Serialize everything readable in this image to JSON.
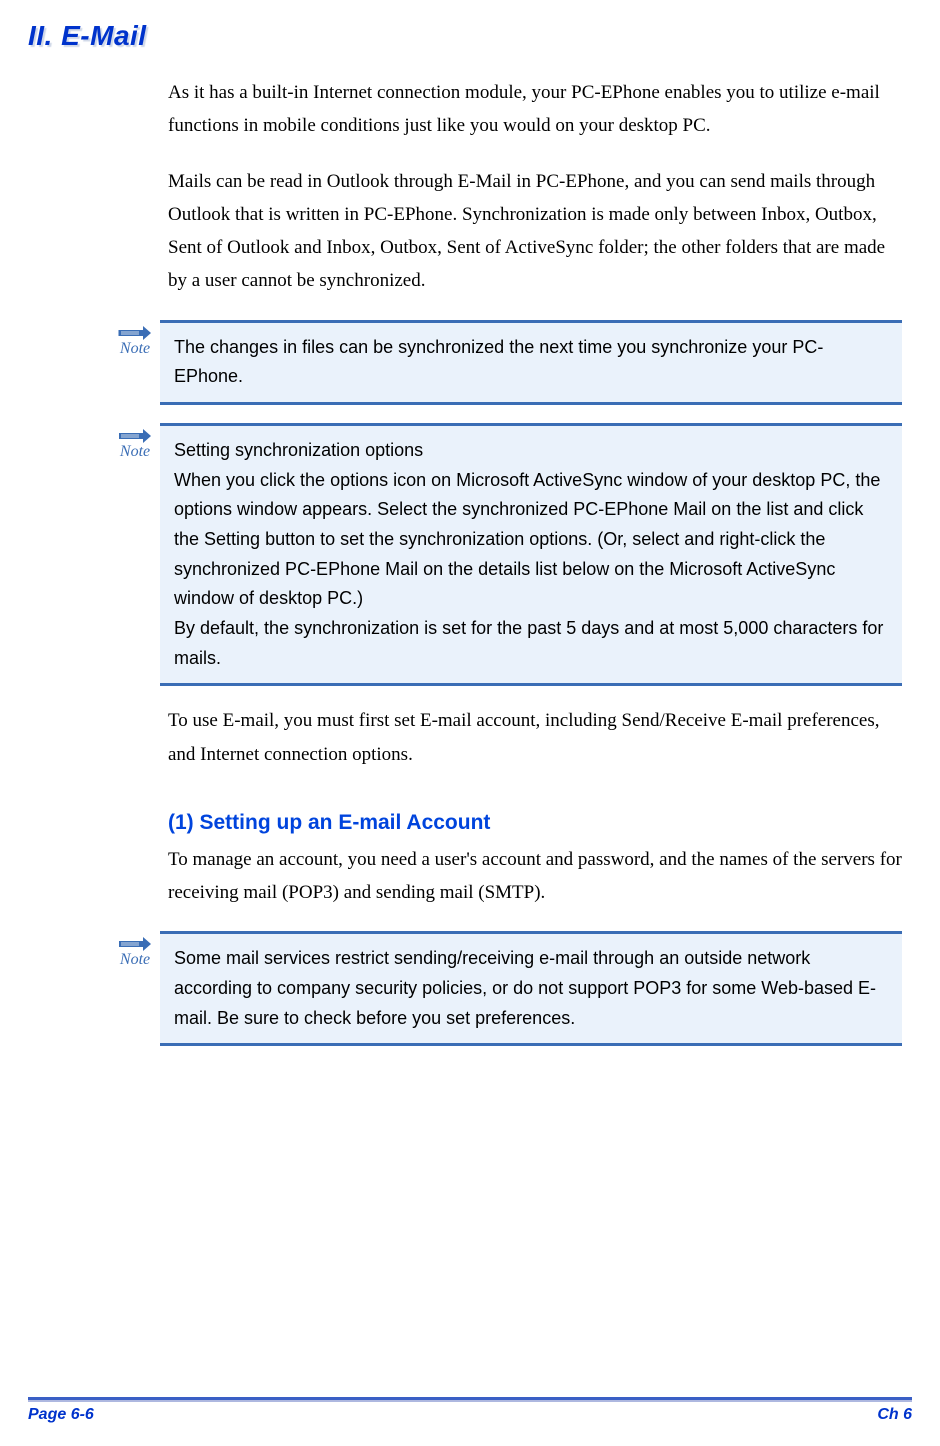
{
  "heading": "II.   E-Mail",
  "para1": "As it has a built-in Internet connection module, your PC-EPhone enables you to utilize e-mail functions in mobile conditions just like you would on your desktop PC.",
  "para2": "Mails can be read in Outlook through E-Mail in PC-EPhone, and you can send mails through Outlook that is written in PC-EPhone. Synchronization is made only between Inbox, Outbox, Sent of Outlook and Inbox, Outbox, Sent of ActiveSync folder; the other folders that are made by a user cannot be synchronized.",
  "noteLabel": "Note",
  "note1": "The changes in files can be synchronized the next time you synchronize your PC-EPhone.",
  "note2_line1": "Setting synchronization options",
  "note2_line2": "When you click the options icon on Microsoft ActiveSync window of your desktop PC, the options window appears. Select the synchronized PC-EPhone Mail on the list and click the Setting button to set the synchronization options. (Or, select and right-click the synchronized PC-EPhone Mail on the details list below on the Microsoft ActiveSync window of desktop PC.)",
  "note2_line3": "By default, the synchronization is set for the past 5 days and at most 5,000 characters for mails.",
  "para3": "To use E-mail, you must first set E-mail account, including Send/Receive E-mail preferences, and Internet connection options.",
  "subHeading": "(1)  Setting up an E-mail Account",
  "para4": "To manage an account, you need a user's account and password, and the names of the servers for receiving mail (POP3) and sending mail (SMTP).",
  "note3": "Some mail services restrict sending/receiving e-mail through an outside network according to company security policies, or do not support POP3 for some Web-based E-mail. Be sure to check before you set preferences.",
  "footerLeft": "Page 6-6",
  "footerRight": "Ch 6"
}
